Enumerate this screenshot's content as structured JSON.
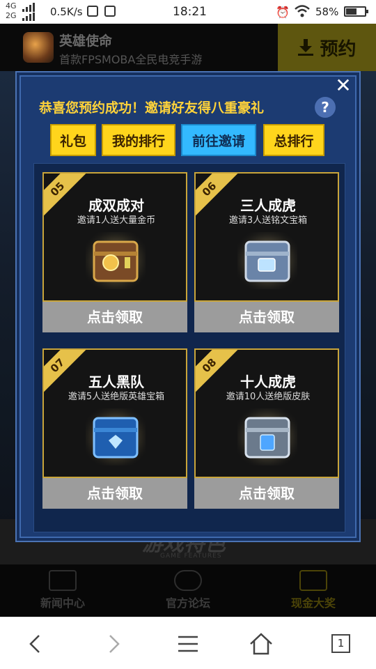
{
  "status": {
    "network": [
      "4G",
      "2G"
    ],
    "speed": "0.5K/s",
    "time": "18:21",
    "battery": "58%",
    "battery_level": 0.58
  },
  "app": {
    "name": "英雄使命",
    "subtitle": "首款FPSMOBA全民电竞手游",
    "reserve_label": "预约"
  },
  "dialog": {
    "title": "恭喜您预约成功！邀请好友得八重豪礼",
    "help_label": "?",
    "close_label": "✕",
    "tabs": [
      {
        "label": "礼包"
      },
      {
        "label": "我的排行"
      },
      {
        "label": "前往邀请"
      },
      {
        "label": "总排行"
      }
    ],
    "active_tab": "前往邀请",
    "rewards": [
      {
        "num": "05",
        "title": "成双成对",
        "desc": "邀请1人送大量金币",
        "button": "点击领取",
        "chest": "gold-coin-chest-icon"
      },
      {
        "num": "06",
        "title": "三人成虎",
        "desc": "邀请3人送铭文宝箱",
        "button": "点击领取",
        "chest": "rune-chest-icon"
      },
      {
        "num": "07",
        "title": "五人黑队",
        "desc": "邀请5人送绝版英雄宝箱",
        "button": "点击领取",
        "chest": "hero-chest-icon"
      },
      {
        "num": "08",
        "title": "十人成虎",
        "desc": "邀请10人送绝版皮肤",
        "button": "点击领取",
        "chest": "skin-chest-icon"
      }
    ]
  },
  "background": {
    "features_title": "游戏特色",
    "features_sub": "GAME FEATURES",
    "nav": [
      {
        "label": "新闻中心",
        "icon": "news-icon"
      },
      {
        "label": "官方论坛",
        "icon": "forum-icon"
      },
      {
        "label": "现金大奖",
        "icon": "cash-prize-icon"
      }
    ]
  },
  "browser": {
    "tab_count": "1"
  },
  "colors": {
    "dialog_bg": "#1c3b72",
    "tab_yellow": "#ffd51c",
    "tab_active": "#33b9ff",
    "title_gold": "#ffd33a",
    "card_border": "#c9a53a",
    "claim_button": "#9c9c9c"
  }
}
